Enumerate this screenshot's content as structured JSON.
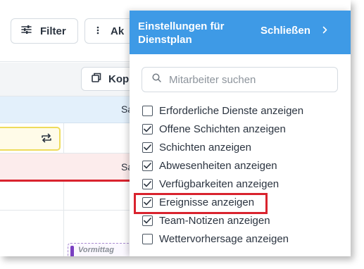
{
  "toolbar": {
    "filter_label": "Filter",
    "actions_label": "Ak"
  },
  "subbar": {
    "copy_label": "Kop"
  },
  "calendar": {
    "day1_label": "Sa",
    "day2_label": "Sa",
    "event_label": "Vormittag"
  },
  "panel": {
    "title": "Einstellungen für Dienstplan",
    "close_label": "Schließen",
    "search_placeholder": "Mitarbeiter suchen",
    "options": [
      {
        "label": "Erforderliche Dienste anzeigen",
        "checked": false
      },
      {
        "label": "Offene Schichten anzeigen",
        "checked": true
      },
      {
        "label": "Schichten anzeigen",
        "checked": true
      },
      {
        "label": "Abwesenheiten anzeigen",
        "checked": true
      },
      {
        "label": "Verfügbarkeiten anzeigen",
        "checked": true
      },
      {
        "label": "Ereignisse anzeigen",
        "checked": true
      },
      {
        "label": "Team-Notizen anzeigen",
        "checked": true
      },
      {
        "label": "Wettervorhersage anzeigen",
        "checked": false
      }
    ]
  },
  "colors": {
    "accent": "#3e9ae6",
    "highlight": "#d9232e",
    "event": "#7a3fc1"
  }
}
